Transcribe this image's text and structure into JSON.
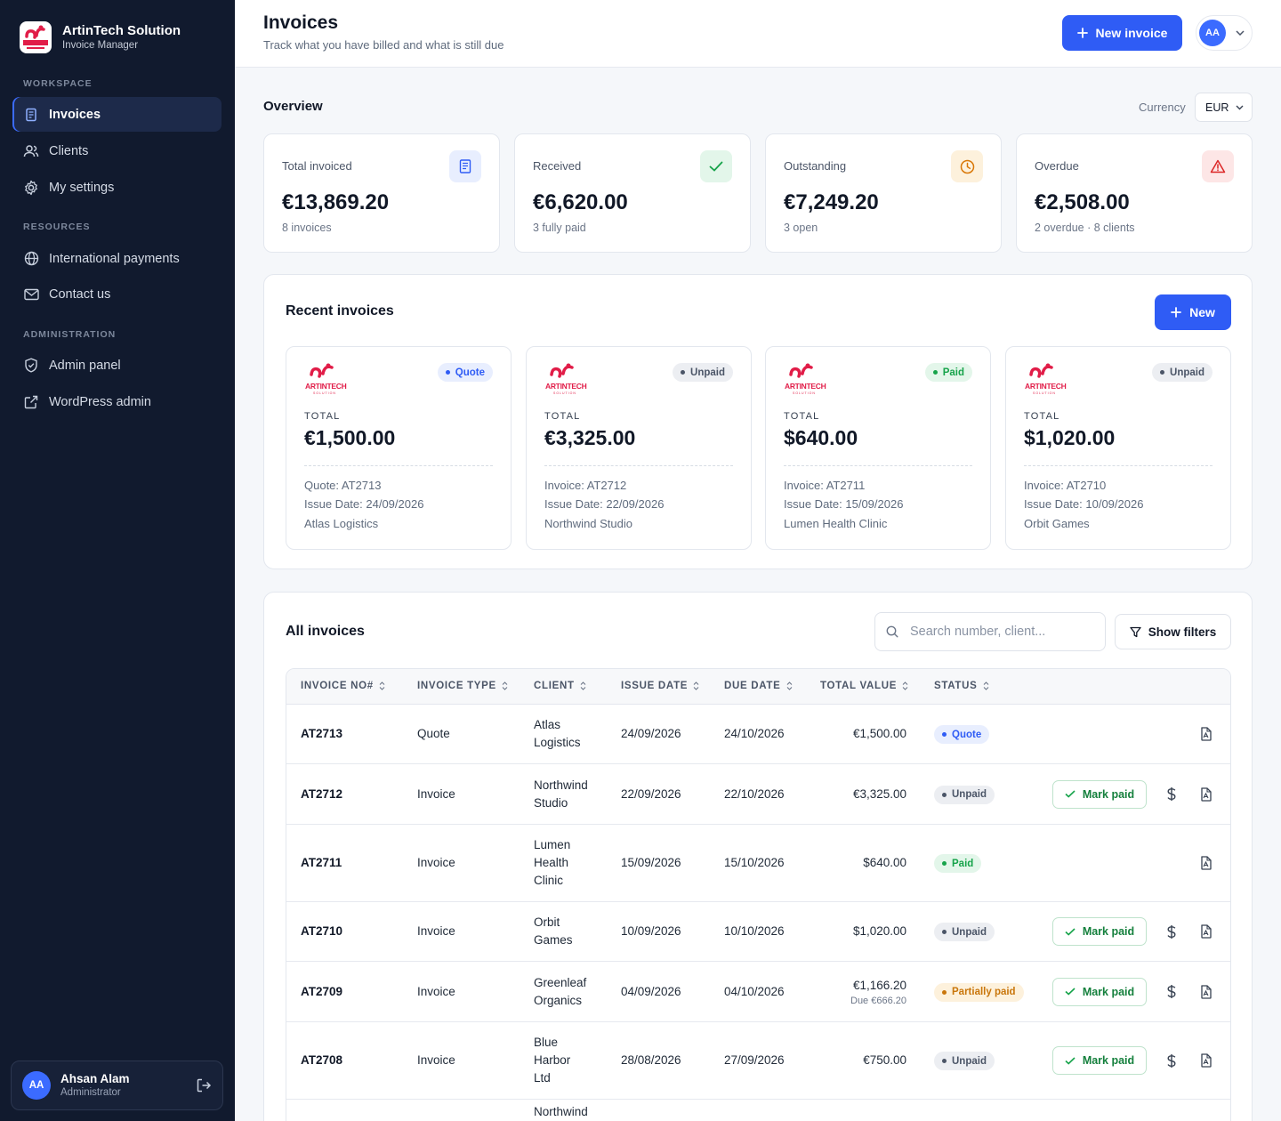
{
  "app": {
    "name": "ArtinTech Solution",
    "subtitle": "Invoice Manager",
    "logo_text": "ARTINTECH",
    "logo_sub": "SOLUTION"
  },
  "sidebar": {
    "sections": [
      {
        "label": "WORKSPACE"
      },
      {
        "label": "RESOURCES"
      },
      {
        "label": "ADMINISTRATION"
      }
    ],
    "items": [
      {
        "label": "Invoices",
        "icon": "receipt-icon",
        "active": true
      },
      {
        "label": "Clients",
        "icon": "users-icon"
      },
      {
        "label": "My settings",
        "icon": "gear-icon"
      },
      {
        "label": "International payments",
        "icon": "globe-icon"
      },
      {
        "label": "Contact us",
        "icon": "mail-icon"
      },
      {
        "label": "Admin panel",
        "icon": "shield-icon"
      },
      {
        "label": "WordPress admin",
        "icon": "external-link-icon"
      }
    ],
    "user": {
      "initials": "AA",
      "name": "Ahsan Alam",
      "role": "Administrator"
    }
  },
  "header": {
    "title": "Invoices",
    "subtitle": "Track what you have billed and what is still due",
    "new_invoice_label": "New invoice",
    "user_initials": "AA"
  },
  "overview": {
    "title": "Overview",
    "currency_label": "Currency",
    "currency_value": "EUR",
    "stats": [
      {
        "label": "Total invoiced",
        "value": "€13,869.20",
        "note": "8 invoices",
        "icon": "receipt-icon",
        "color": "#2f5cf5"
      },
      {
        "label": "Received",
        "value": "€6,620.00",
        "note": "3 fully paid",
        "icon": "check-icon",
        "color": "#16a34a"
      },
      {
        "label": "Outstanding",
        "value": "€7,249.20",
        "note": "3 open",
        "icon": "clock-icon",
        "color": "#d97706"
      },
      {
        "label": "Overdue",
        "value": "€2,508.00",
        "note": "2 overdue · 8 clients",
        "icon": "alert-triangle-icon",
        "color": "#dc2626"
      }
    ]
  },
  "recent": {
    "title": "Recent invoices",
    "new_label": "New",
    "total_label": "TOTAL",
    "cards": [
      {
        "status": "Quote",
        "total": "€1,500.00",
        "line1": "Quote: AT2713",
        "line2": "Issue Date: 24/09/2026",
        "line3": "Atlas Logistics"
      },
      {
        "status": "Unpaid",
        "total": "€3,325.00",
        "line1": "Invoice: AT2712",
        "line2": "Issue Date: 22/09/2026",
        "line3": "Northwind Studio"
      },
      {
        "status": "Paid",
        "total": "$640.00",
        "line1": "Invoice: AT2711",
        "line2": "Issue Date: 15/09/2026",
        "line3": "Lumen Health Clinic"
      },
      {
        "status": "Unpaid",
        "total": "$1,020.00",
        "line1": "Invoice: AT2710",
        "line2": "Issue Date: 10/09/2026",
        "line3": "Orbit Games"
      }
    ]
  },
  "all": {
    "title": "All invoices",
    "search_placeholder": "Search number, client...",
    "filters_label": "Show filters",
    "mark_paid_label": "Mark paid",
    "columns": [
      "INVOICE NO#",
      "INVOICE TYPE",
      "CLIENT",
      "ISSUE DATE",
      "DUE DATE",
      "TOTAL VALUE",
      "STATUS"
    ],
    "rows": [
      {
        "no": "AT2713",
        "type": "Quote",
        "client": "Atlas Logistics",
        "issue": "24/09/2026",
        "due": "24/10/2026",
        "total": "€1,500.00",
        "due_note": "",
        "status": "Quote"
      },
      {
        "no": "AT2712",
        "type": "Invoice",
        "client": "Northwind Studio",
        "issue": "22/09/2026",
        "due": "22/10/2026",
        "total": "€3,325.00",
        "due_note": "",
        "status": "Unpaid"
      },
      {
        "no": "AT2711",
        "type": "Invoice",
        "client": "Lumen Health Clinic",
        "issue": "15/09/2026",
        "due": "15/10/2026",
        "total": "$640.00",
        "due_note": "",
        "status": "Paid"
      },
      {
        "no": "AT2710",
        "type": "Invoice",
        "client": "Orbit Games",
        "issue": "10/09/2026",
        "due": "10/10/2026",
        "total": "$1,020.00",
        "due_note": "",
        "status": "Unpaid"
      },
      {
        "no": "AT2709",
        "type": "Invoice",
        "client": "Greenleaf Organics",
        "issue": "04/09/2026",
        "due": "04/10/2026",
        "total": "€1,166.20",
        "due_note": "Due €666.20",
        "status": "Partially paid"
      },
      {
        "no": "AT2708",
        "type": "Invoice",
        "client": "Blue Harbor Ltd",
        "issue": "28/08/2026",
        "due": "27/09/2026",
        "total": "€750.00",
        "due_note": "",
        "status": "Unpaid"
      },
      {
        "no": "",
        "type": "",
        "client": "Northwind",
        "issue": "",
        "due": "",
        "total": "",
        "due_note": "",
        "status": ""
      }
    ]
  }
}
